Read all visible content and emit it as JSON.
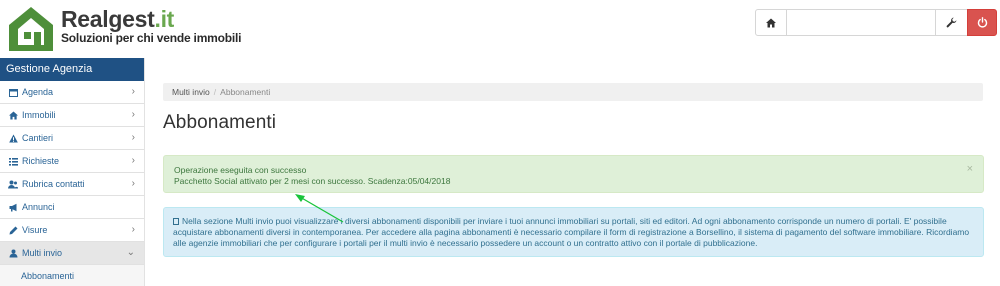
{
  "brand": {
    "title_main": "Realgest",
    "title_tld": ".it",
    "subtitle": "Soluzioni per chi vende immobili"
  },
  "topbar": {
    "home_icon": "home-icon",
    "search_value": "",
    "wrench_icon": "wrench-icon",
    "power_icon": "power-icon",
    "power_color": "#d9534f"
  },
  "sidebar": {
    "header": "Gestione Agenzia",
    "header_color": "#1f5184",
    "items": [
      {
        "label": "Agenda",
        "icon": "calendar-icon",
        "chevron": "›"
      },
      {
        "label": "Immobili",
        "icon": "home-icon",
        "chevron": "›"
      },
      {
        "label": "Cantieri",
        "icon": "warning-icon",
        "chevron": "›"
      },
      {
        "label": "Richieste",
        "icon": "list-icon",
        "chevron": "›"
      },
      {
        "label": "Rubrica contatti",
        "icon": "users-icon",
        "chevron": "›"
      },
      {
        "label": "Annunci",
        "icon": "megaphone-icon",
        "chevron": ""
      },
      {
        "label": "Visure",
        "icon": "pencil-icon",
        "chevron": "›"
      },
      {
        "label": "Multi invio",
        "icon": "user-upload-icon",
        "chevron": "⌄"
      }
    ],
    "sub_item": "Abbonamenti"
  },
  "breadcrumb": {
    "parent": "Multi invio",
    "separator": "/",
    "current": "Abbonamenti"
  },
  "page": {
    "title": "Abbonamenti"
  },
  "alert_success": {
    "line1": "Operazione eseguita con successo",
    "line2": "Pacchetto Social attivato per 2 mesi con successo. Scadenza:05/04/2018",
    "close": "×",
    "color": "#dff0d8"
  },
  "alert_info": {
    "icon": "info-icon",
    "text": "Nella sezione Multi invio puoi visualizzare i diversi abbonamenti disponibili per inviare i tuoi annunci immobiliari su portali, siti ed editori. Ad ogni abbonamento corrisponde un numero di portali. E' possibile acquistare abbonamenti diversi in contemporanea. Per accedere alla pagina abbonamenti è necessario compilare il form di registrazione a Borsellino, il sistema di pagamento del software immobiliare. Ricordiamo alle agenzie immobiliari che per configurare i portali per il multi invio è necessario possedere un account o un contratto attivo con il portale di pubblicazione.",
    "color": "#d9edf7"
  },
  "annotation": {
    "arrow_color": "#19c43a"
  }
}
